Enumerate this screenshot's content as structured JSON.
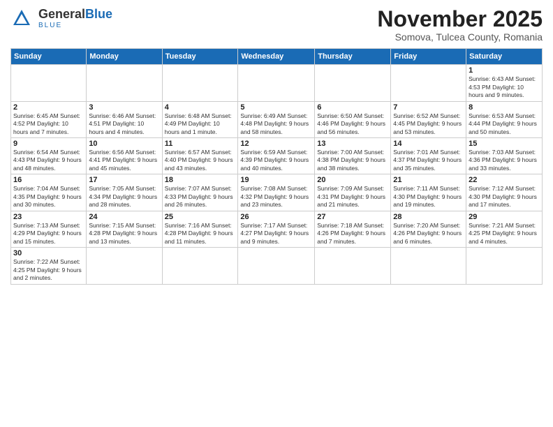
{
  "logo": {
    "text_general": "General",
    "text_blue": "Blue",
    "sub": "BLUE"
  },
  "header": {
    "month": "November 2025",
    "location": "Somova, Tulcea County, Romania"
  },
  "weekdays": [
    "Sunday",
    "Monday",
    "Tuesday",
    "Wednesday",
    "Thursday",
    "Friday",
    "Saturday"
  ],
  "weeks": [
    [
      {
        "day": "",
        "info": ""
      },
      {
        "day": "",
        "info": ""
      },
      {
        "day": "",
        "info": ""
      },
      {
        "day": "",
        "info": ""
      },
      {
        "day": "",
        "info": ""
      },
      {
        "day": "",
        "info": ""
      },
      {
        "day": "1",
        "info": "Sunrise: 6:43 AM\nSunset: 4:53 PM\nDaylight: 10 hours\nand 9 minutes."
      }
    ],
    [
      {
        "day": "2",
        "info": "Sunrise: 6:45 AM\nSunset: 4:52 PM\nDaylight: 10 hours\nand 7 minutes."
      },
      {
        "day": "3",
        "info": "Sunrise: 6:46 AM\nSunset: 4:51 PM\nDaylight: 10 hours\nand 4 minutes."
      },
      {
        "day": "4",
        "info": "Sunrise: 6:48 AM\nSunset: 4:49 PM\nDaylight: 10 hours\nand 1 minute."
      },
      {
        "day": "5",
        "info": "Sunrise: 6:49 AM\nSunset: 4:48 PM\nDaylight: 9 hours\nand 58 minutes."
      },
      {
        "day": "6",
        "info": "Sunrise: 6:50 AM\nSunset: 4:46 PM\nDaylight: 9 hours\nand 56 minutes."
      },
      {
        "day": "7",
        "info": "Sunrise: 6:52 AM\nSunset: 4:45 PM\nDaylight: 9 hours\nand 53 minutes."
      },
      {
        "day": "8",
        "info": "Sunrise: 6:53 AM\nSunset: 4:44 PM\nDaylight: 9 hours\nand 50 minutes."
      }
    ],
    [
      {
        "day": "9",
        "info": "Sunrise: 6:54 AM\nSunset: 4:43 PM\nDaylight: 9 hours\nand 48 minutes."
      },
      {
        "day": "10",
        "info": "Sunrise: 6:56 AM\nSunset: 4:41 PM\nDaylight: 9 hours\nand 45 minutes."
      },
      {
        "day": "11",
        "info": "Sunrise: 6:57 AM\nSunset: 4:40 PM\nDaylight: 9 hours\nand 43 minutes."
      },
      {
        "day": "12",
        "info": "Sunrise: 6:59 AM\nSunset: 4:39 PM\nDaylight: 9 hours\nand 40 minutes."
      },
      {
        "day": "13",
        "info": "Sunrise: 7:00 AM\nSunset: 4:38 PM\nDaylight: 9 hours\nand 38 minutes."
      },
      {
        "day": "14",
        "info": "Sunrise: 7:01 AM\nSunset: 4:37 PM\nDaylight: 9 hours\nand 35 minutes."
      },
      {
        "day": "15",
        "info": "Sunrise: 7:03 AM\nSunset: 4:36 PM\nDaylight: 9 hours\nand 33 minutes."
      }
    ],
    [
      {
        "day": "16",
        "info": "Sunrise: 7:04 AM\nSunset: 4:35 PM\nDaylight: 9 hours\nand 30 minutes."
      },
      {
        "day": "17",
        "info": "Sunrise: 7:05 AM\nSunset: 4:34 PM\nDaylight: 9 hours\nand 28 minutes."
      },
      {
        "day": "18",
        "info": "Sunrise: 7:07 AM\nSunset: 4:33 PM\nDaylight: 9 hours\nand 26 minutes."
      },
      {
        "day": "19",
        "info": "Sunrise: 7:08 AM\nSunset: 4:32 PM\nDaylight: 9 hours\nand 23 minutes."
      },
      {
        "day": "20",
        "info": "Sunrise: 7:09 AM\nSunset: 4:31 PM\nDaylight: 9 hours\nand 21 minutes."
      },
      {
        "day": "21",
        "info": "Sunrise: 7:11 AM\nSunset: 4:30 PM\nDaylight: 9 hours\nand 19 minutes."
      },
      {
        "day": "22",
        "info": "Sunrise: 7:12 AM\nSunset: 4:30 PM\nDaylight: 9 hours\nand 17 minutes."
      }
    ],
    [
      {
        "day": "23",
        "info": "Sunrise: 7:13 AM\nSunset: 4:29 PM\nDaylight: 9 hours\nand 15 minutes."
      },
      {
        "day": "24",
        "info": "Sunrise: 7:15 AM\nSunset: 4:28 PM\nDaylight: 9 hours\nand 13 minutes."
      },
      {
        "day": "25",
        "info": "Sunrise: 7:16 AM\nSunset: 4:28 PM\nDaylight: 9 hours\nand 11 minutes."
      },
      {
        "day": "26",
        "info": "Sunrise: 7:17 AM\nSunset: 4:27 PM\nDaylight: 9 hours\nand 9 minutes."
      },
      {
        "day": "27",
        "info": "Sunrise: 7:18 AM\nSunset: 4:26 PM\nDaylight: 9 hours\nand 7 minutes."
      },
      {
        "day": "28",
        "info": "Sunrise: 7:20 AM\nSunset: 4:26 PM\nDaylight: 9 hours\nand 6 minutes."
      },
      {
        "day": "29",
        "info": "Sunrise: 7:21 AM\nSunset: 4:25 PM\nDaylight: 9 hours\nand 4 minutes."
      }
    ],
    [
      {
        "day": "30",
        "info": "Sunrise: 7:22 AM\nSunset: 4:25 PM\nDaylight: 9 hours\nand 2 minutes."
      },
      {
        "day": "",
        "info": ""
      },
      {
        "day": "",
        "info": ""
      },
      {
        "day": "",
        "info": ""
      },
      {
        "day": "",
        "info": ""
      },
      {
        "day": "",
        "info": ""
      },
      {
        "day": "",
        "info": ""
      }
    ]
  ]
}
